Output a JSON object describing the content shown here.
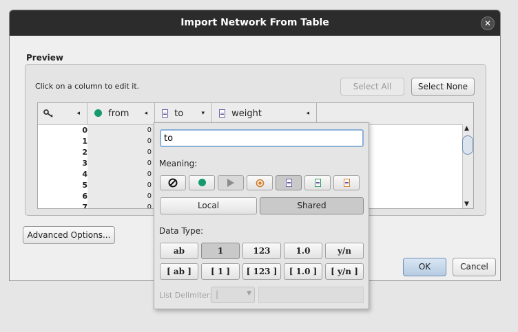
{
  "dialog": {
    "title": "Import Network From Table",
    "close_glyph": "✕",
    "preview_label": "Preview",
    "hint": "Click on a column to edit it.",
    "select_all": "Select All",
    "select_none": "Select None",
    "advanced_options": "Advanced Options...",
    "ok": "OK",
    "cancel": "Cancel"
  },
  "table": {
    "columns": [
      {
        "name": "",
        "icon": "key-icon",
        "arrow": "◂"
      },
      {
        "name": "from",
        "icon": "source-node-icon",
        "arrow": "◂"
      },
      {
        "name": "to",
        "icon": "document-icon",
        "arrow": "▾"
      },
      {
        "name": "weight",
        "icon": "document-icon",
        "arrow": "◂"
      }
    ],
    "rows": [
      {
        "idx": "0",
        "from": "0"
      },
      {
        "idx": "1",
        "from": "0"
      },
      {
        "idx": "2",
        "from": "0"
      },
      {
        "idx": "3",
        "from": "0"
      },
      {
        "idx": "4",
        "from": "0"
      },
      {
        "idx": "5",
        "from": "0"
      },
      {
        "idx": "6",
        "from": "0"
      },
      {
        "idx": "7",
        "from": "0"
      }
    ]
  },
  "editor": {
    "column_name_value": "to",
    "meaning_label": "Meaning:",
    "meaning_buttons": [
      {
        "icon": "none-icon",
        "glyph": "⊘"
      },
      {
        "icon": "source-node-icon",
        "glyph": "●"
      },
      {
        "icon": "interaction-icon",
        "glyph": "▶"
      },
      {
        "icon": "target-node-icon",
        "glyph": "◉"
      },
      {
        "icon": "source-attribute-icon",
        "glyph": "▤"
      },
      {
        "icon": "edge-attribute-icon",
        "glyph": "▤"
      },
      {
        "icon": "target-attribute-icon",
        "glyph": "▤"
      }
    ],
    "scope_local": "Local",
    "scope_shared": "Shared",
    "data_type_label": "Data Type:",
    "data_types": [
      "ab",
      "1",
      "123",
      "1.0",
      "y/n"
    ],
    "list_types": [
      "[ ab ]",
      "[ 1 ]",
      "[ 123 ]",
      "[ 1.0 ]",
      "[ y/n ]"
    ],
    "list_delimiter_label": "List Delimiter:",
    "list_delimiter_value": "|"
  },
  "colors": {
    "title_bar": "#2c2c2c",
    "source_green": "#159a6e",
    "attribute_purple": "#6a5fa8",
    "edge_attr_green": "#2c9a5c",
    "target_orange": "#d77a22",
    "focus_blue": "#8bb0d8"
  }
}
